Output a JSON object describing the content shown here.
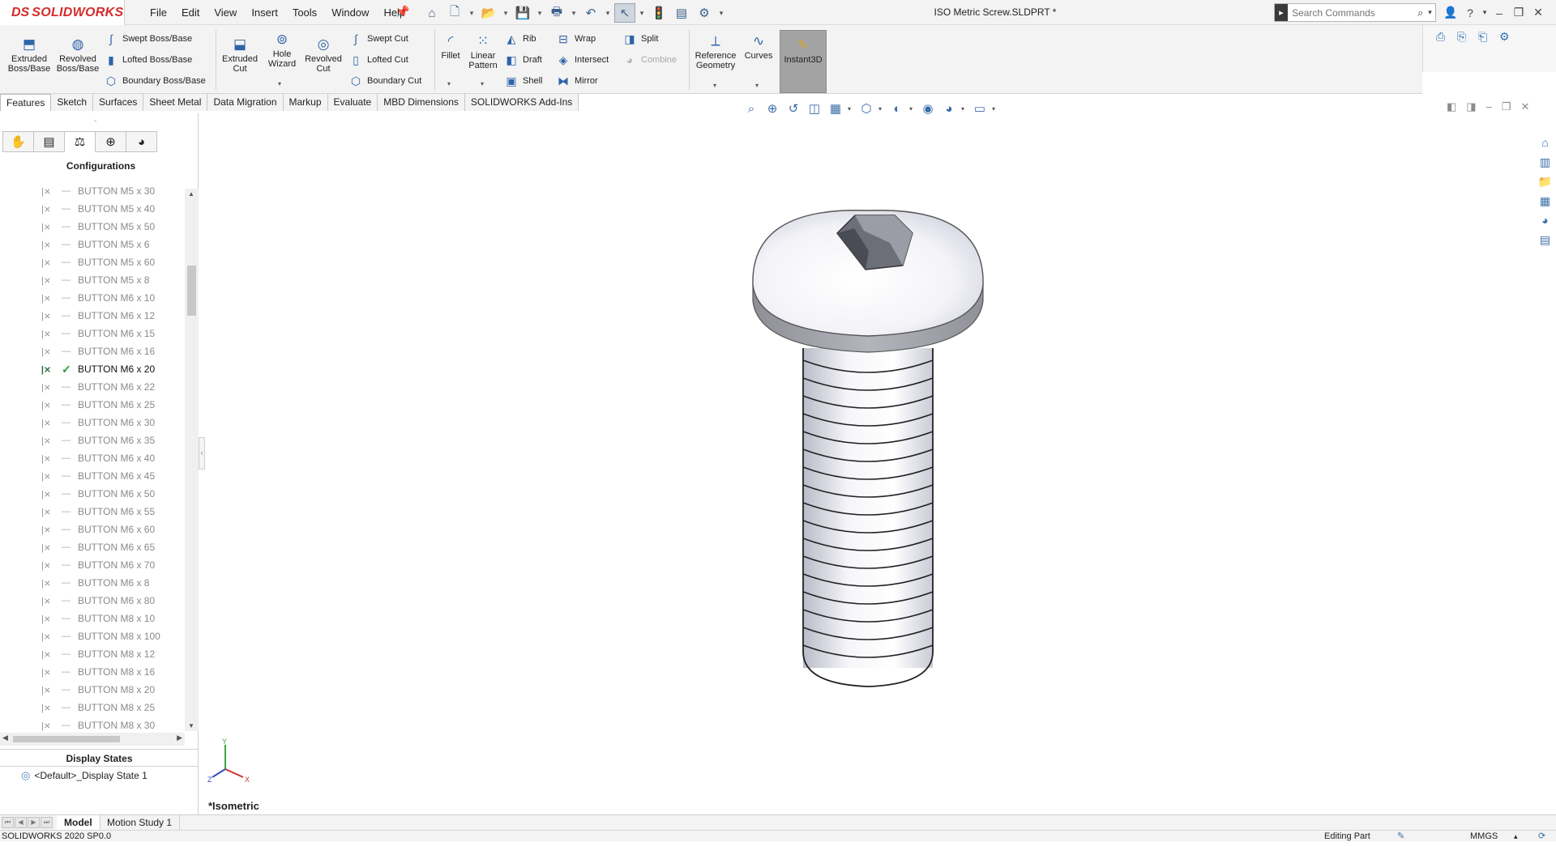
{
  "app": {
    "brand": "SOLIDWORKS",
    "brand_prefix": "DS",
    "document_title": "ISO Metric Screw.SLDPRT *"
  },
  "menu": [
    "File",
    "Edit",
    "View",
    "Insert",
    "Tools",
    "Window",
    "Help"
  ],
  "search": {
    "placeholder": "Search Commands"
  },
  "ribbon": {
    "extruded_boss": "Extruded Boss/Base",
    "revolved_boss": "Revolved Boss/Base",
    "swept_boss": "Swept Boss/Base",
    "lofted_boss": "Lofted Boss/Base",
    "boundary_boss": "Boundary Boss/Base",
    "extruded_cut": "Extruded Cut",
    "hole_wizard": "Hole Wizard",
    "revolved_cut": "Revolved Cut",
    "swept_cut": "Swept Cut",
    "lofted_cut": "Lofted Cut",
    "boundary_cut": "Boundary Cut",
    "fillet": "Fillet",
    "linear_pattern": "Linear Pattern",
    "rib": "Rib",
    "draft": "Draft",
    "shell": "Shell",
    "wrap": "Wrap",
    "intersect": "Intersect",
    "mirror": "Mirror",
    "split": "Split",
    "combine": "Combine",
    "reference_geometry": "Reference Geometry",
    "curves": "Curves",
    "instant3d": "Instant3D"
  },
  "tabs": [
    "Features",
    "Sketch",
    "Surfaces",
    "Sheet Metal",
    "Data Migration",
    "Markup",
    "Evaluate",
    "MBD Dimensions",
    "SOLIDWORKS Add-Ins"
  ],
  "panel": {
    "title": "Configurations",
    "configurations": [
      "BUTTON M5 x 30",
      "BUTTON M5 x 40",
      "BUTTON M5 x 50",
      "BUTTON M5 x 6",
      "BUTTON M5 x 60",
      "BUTTON M5 x 8",
      "BUTTON M6 x 10",
      "BUTTON M6 x 12",
      "BUTTON M6 x 15",
      "BUTTON M6 x 16",
      "BUTTON M6 x 20",
      "BUTTON M6 x 22",
      "BUTTON M6 x 25",
      "BUTTON M6 x 30",
      "BUTTON M6 x 35",
      "BUTTON M6 x 40",
      "BUTTON M6 x 45",
      "BUTTON M6 x 50",
      "BUTTON M6 x 55",
      "BUTTON M6 x 60",
      "BUTTON M6 x 65",
      "BUTTON M6 x 70",
      "BUTTON M6 x 8",
      "BUTTON M6 x 80",
      "BUTTON M8 x 10",
      "BUTTON M8 x 100",
      "BUTTON M8 x 12",
      "BUTTON M8 x 16",
      "BUTTON M8 x 20",
      "BUTTON M8 x 25",
      "BUTTON M8 x 30"
    ],
    "active_configuration": "BUTTON M6 x 20",
    "display_states_title": "Display States",
    "display_state": "<Default>_Display State 1"
  },
  "viewport": {
    "view_name": "*Isometric",
    "triad": {
      "y": "Y",
      "x": "X",
      "z": "Z"
    }
  },
  "bottom_tabs": [
    "Model",
    "Motion Study 1"
  ],
  "status": {
    "version": "SOLIDWORKS 2020 SP0.0",
    "mode": "Editing Part",
    "units": "MMGS"
  },
  "colors": {
    "brand_red": "#d42b2b",
    "accent_blue": "#2f64a8",
    "active_check": "#2a9a3a"
  }
}
